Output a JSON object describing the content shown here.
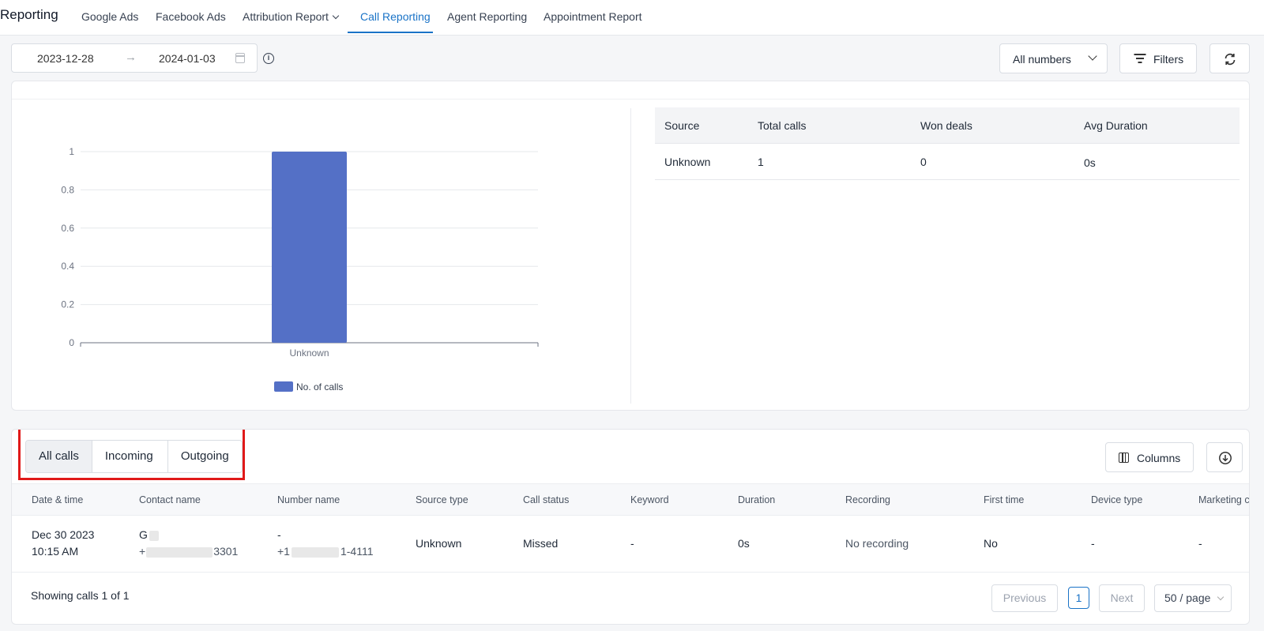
{
  "nav": {
    "brand": "Reporting",
    "items": [
      {
        "label": "Google Ads"
      },
      {
        "label": "Facebook Ads"
      },
      {
        "label": "Attribution Report"
      },
      {
        "label": "Call Reporting"
      },
      {
        "label": "Agent Reporting"
      },
      {
        "label": "Appointment Report"
      }
    ],
    "active": "Call Reporting"
  },
  "toolbar": {
    "date_start": "2023-12-28",
    "date_end": "2024-01-03",
    "numbers_label": "All numbers",
    "filters_label": "Filters"
  },
  "chart_data": {
    "type": "bar",
    "categories": [
      "Unknown"
    ],
    "series": [
      {
        "name": "No. of calls",
        "values": [
          1
        ]
      }
    ],
    "ylim": [
      0,
      1
    ],
    "yticks": [
      "0",
      "0.2",
      "0.4",
      "0.6",
      "0.8",
      "1"
    ],
    "grid": true,
    "legend": "bottom",
    "color": "#5470c6"
  },
  "source_table": {
    "headers": [
      "Source",
      "Total calls",
      "Won deals",
      "Avg Duration"
    ],
    "rows": [
      [
        "Unknown",
        "1",
        "0",
        "0s"
      ]
    ]
  },
  "calls": {
    "segments": [
      "All calls",
      "Incoming",
      "Outgoing"
    ],
    "active_segment": "All calls",
    "columns_label": "Columns",
    "headers": [
      "Date & time",
      "Contact name",
      "Number name",
      "Source type",
      "Call status",
      "Keyword",
      "Duration",
      "Recording",
      "First time",
      "Device type",
      "Marketing c"
    ],
    "row": {
      "date": "Dec 30 2023",
      "time": "10:15 AM",
      "contact_name": "G",
      "contact_phone_prefix": "+",
      "contact_phone_suffix": "3301",
      "number_name": "-",
      "number_phone_prefix": "+1",
      "number_phone_suffix": "1-4111",
      "source_type": "Unknown",
      "call_status": "Missed",
      "keyword": "-",
      "duration": "0s",
      "recording": "No recording",
      "first_time": "No",
      "device_type": "-",
      "marketing": "-"
    },
    "showing": "Showing calls 1 of 1",
    "pagination": {
      "previous": "Previous",
      "page": "1",
      "next": "Next",
      "page_size": "50 / page"
    }
  }
}
